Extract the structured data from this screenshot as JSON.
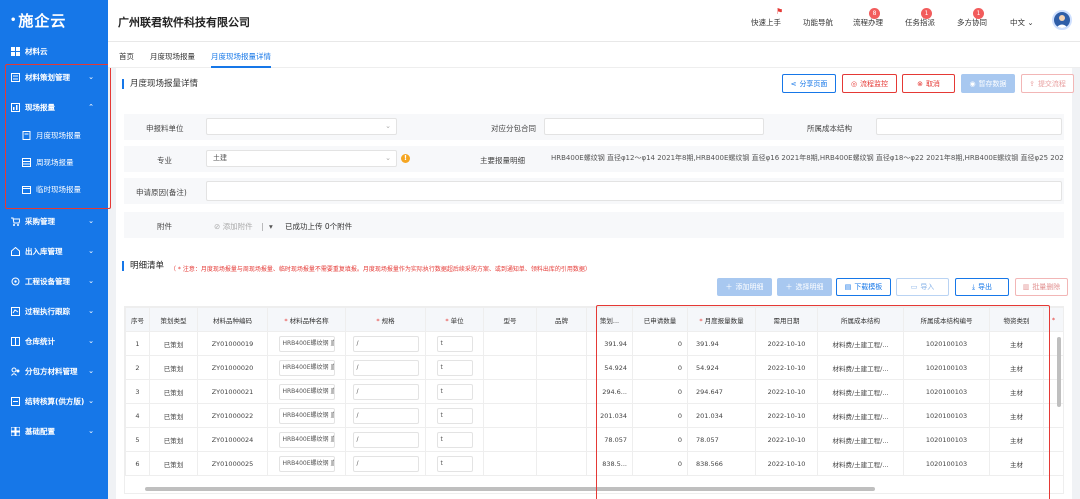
{
  "app": {
    "logo": "施企云",
    "company": "广州联君软件科技有限公司"
  },
  "sidebar": {
    "items": [
      {
        "label": "材料云",
        "icon": "grid-icon"
      },
      {
        "label": "材料策划管理",
        "icon": "plan-icon"
      },
      {
        "label": "现场报量",
        "icon": "report-icon"
      },
      {
        "label": "月度现场报量",
        "icon": "doc-icon"
      },
      {
        "label": "周现场报量",
        "icon": "table-icon"
      },
      {
        "label": "临时现场报量",
        "icon": "calendar-icon"
      },
      {
        "label": "采购管理",
        "icon": "cart-icon"
      },
      {
        "label": "出入库管理",
        "icon": "warehouse-icon"
      },
      {
        "label": "工程设备管理",
        "icon": "gear-icon"
      },
      {
        "label": "过程执行跟踪",
        "icon": "track-icon"
      },
      {
        "label": "仓库统计",
        "icon": "stats-icon"
      },
      {
        "label": "分包方材料管理",
        "icon": "subcontract-icon"
      },
      {
        "label": "结转核算(供方版)",
        "icon": "settle-icon"
      },
      {
        "label": "基础配置",
        "icon": "config-icon"
      }
    ]
  },
  "topnav": {
    "items": [
      {
        "label": "快速上手"
      },
      {
        "label": "功能导航"
      },
      {
        "label": "流程办理",
        "badge": "8"
      },
      {
        "label": "任务指派",
        "badge": "1"
      },
      {
        "label": "多方协同",
        "badge": "1"
      },
      {
        "label": "中文"
      }
    ]
  },
  "tabs": [
    {
      "label": "首页"
    },
    {
      "label": "月度现场报量"
    },
    {
      "label": "月度现场报量详情"
    }
  ],
  "page": {
    "title": "月度现场报量详情",
    "buttons": {
      "share": "分享页面",
      "monitor": "流程监控",
      "cancel": "取消",
      "save_draft": "暂存数据",
      "submit": "提交流程"
    }
  },
  "form": {
    "applicant_unit_label": "申报料单位",
    "applicant_unit_value": "",
    "subcontract_label": "对应分包合同",
    "cost_structure_label": "所属成本结构",
    "major_label": "专业",
    "major_value": "土建",
    "main_detail_label": "主要报量明细",
    "main_detail_value": "HRB400E螺纹钢 直径φ12～φ14 2021年8期,HRB400E螺纹钢 直径φ16 2021年8期,HRB400E螺纹钢 直径φ18～φ22 2021年8期,HRB400E螺纹钢 直径φ25 2021年",
    "reason_label": "申请原因(备注)",
    "attach_label": "附件",
    "attach_add": "添加附件",
    "attach_status": "已成功上传 0个附件"
  },
  "detail": {
    "title": "明细清单",
    "notice": "（ * 注意：月度现场报量与周现场报量、临时现场报量不需要重复填报。月度现场报量作为实际执行数据超后续采购方案、或到通知单、领料出库的引用数据）",
    "buttons": {
      "add_detail": "添加明细",
      "select_detail": "选择明细",
      "download_template": "下载模板",
      "import": "导入",
      "export": "导出",
      "batch_delete": "批量删除"
    }
  },
  "table": {
    "columns": [
      "序号",
      "策划类型",
      "材料品种编码",
      "材料品种名称",
      "规格",
      "单位",
      "型号",
      "品牌",
      "策划...",
      "已申请数量",
      "月度报量数量",
      "需用日期",
      "所属成本结构",
      "所属成本结构编号",
      "物资类别"
    ],
    "rows": [
      {
        "no": "1",
        "type": "已策划",
        "code": "ZY01000019",
        "name": "HRB400E螺纹钢 直",
        "spec": "/",
        "unit": "t",
        "plan": "391.94",
        "applied": "0",
        "monthly": "391.94",
        "date": "2022-10-10",
        "cost": "材料费/土建工程/...",
        "cost_no": "1020100103",
        "category": "主材"
      },
      {
        "no": "2",
        "type": "已策划",
        "code": "ZY01000020",
        "name": "HRB400E螺纹钢 直",
        "spec": "/",
        "unit": "t",
        "plan": "54.924",
        "applied": "0",
        "monthly": "54.924",
        "date": "2022-10-10",
        "cost": "材料费/土建工程/...",
        "cost_no": "1020100103",
        "category": "主材"
      },
      {
        "no": "3",
        "type": "已策划",
        "code": "ZY01000021",
        "name": "HRB400E螺纹钢 直",
        "spec": "/",
        "unit": "t",
        "plan": "294.6...",
        "applied": "0",
        "monthly": "294.647",
        "date": "2022-10-10",
        "cost": "材料费/土建工程/...",
        "cost_no": "1020100103",
        "category": "主材"
      },
      {
        "no": "4",
        "type": "已策划",
        "code": "ZY01000022",
        "name": "HRB400E螺纹钢 直",
        "spec": "/",
        "unit": "t",
        "plan": "201.034",
        "applied": "0",
        "monthly": "201.034",
        "date": "2022-10-10",
        "cost": "材料费/土建工程/...",
        "cost_no": "1020100103",
        "category": "主材"
      },
      {
        "no": "5",
        "type": "已策划",
        "code": "ZY01000024",
        "name": "HRB400E螺纹钢 直",
        "spec": "/",
        "unit": "t",
        "plan": "78.057",
        "applied": "0",
        "monthly": "78.057",
        "date": "2022-10-10",
        "cost": "材料费/土建工程/...",
        "cost_no": "1020100103",
        "category": "主材"
      },
      {
        "no": "6",
        "type": "已策划",
        "code": "ZY01000025",
        "name": "HRB400E螺纹钢 直",
        "spec": "/",
        "unit": "t",
        "plan": "838.5...",
        "applied": "0",
        "monthly": "838.566",
        "date": "2022-10-10",
        "cost": "材料费/土建工程/...",
        "cost_no": "1020100103",
        "category": "主材"
      }
    ]
  },
  "colors": {
    "primary": "#1677e8",
    "danger": "#e53935",
    "warning": "#f5a623"
  }
}
